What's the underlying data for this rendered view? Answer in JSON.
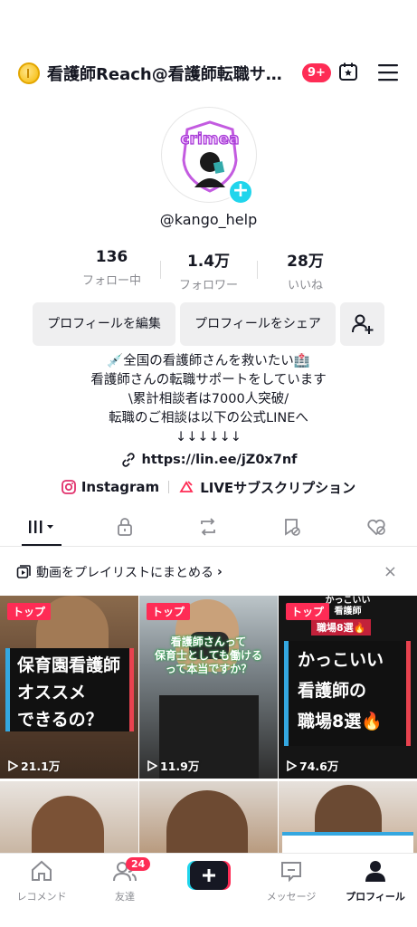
{
  "header": {
    "title": "看護師Reach@看護師転職サ…",
    "notif_count": "9+",
    "coin_icon": "coin-icon",
    "calendar_icon": "calendar-icon",
    "menu_icon": "hamburger-menu-icon"
  },
  "profile": {
    "avatar_text": "crimea",
    "username": "@kango_help"
  },
  "stats": [
    {
      "value": "136",
      "label": "フォロー中"
    },
    {
      "value": "1.4万",
      "label": "フォロワー"
    },
    {
      "value": "28万",
      "label": "いいね"
    }
  ],
  "actions": {
    "edit": "プロフィールを編集",
    "share": "プロフィールをシェア"
  },
  "bio": {
    "line1": "💉全国の看護師さんを救いたい🏥",
    "line2": "看護師さんの転職サポートをしています",
    "line3": "\\累計相談者は7000人突破/",
    "line4": "転職のご相談は以下の公式LINEへ",
    "line5": "↓↓↓↓↓↓"
  },
  "link": "https://lin.ee/jZ0x7nf",
  "social": {
    "instagram": "Instagram",
    "live": "LIVEサブスクリプション"
  },
  "playlist": {
    "text": "動画をプレイリストにまとめる",
    "chevron": "›",
    "close": "×"
  },
  "videos": [
    {
      "tag": "トップ",
      "views": "21.1万",
      "caption": "保育園看護師\nオススメ\nできるの？"
    },
    {
      "tag": "トップ",
      "views": "11.9万",
      "caption": "看護師さんって\n保育士としても働ける\nって本当ですか？"
    },
    {
      "tag": "トップ",
      "views": "74.6万",
      "caption_top1": "かっこいい",
      "caption_top2": "看護師",
      "caption_top3": "職場8選🔥",
      "caption": "かっこいい\n看護師の\n職場8選🔥"
    }
  ],
  "nav": {
    "home": "レコメンド",
    "friends": "友達",
    "friends_badge": "24",
    "inbox": "メッセージ",
    "profile": "プロフィール"
  },
  "colors": {
    "accent": "#fe2c55",
    "cyan": "#20d5ec"
  }
}
